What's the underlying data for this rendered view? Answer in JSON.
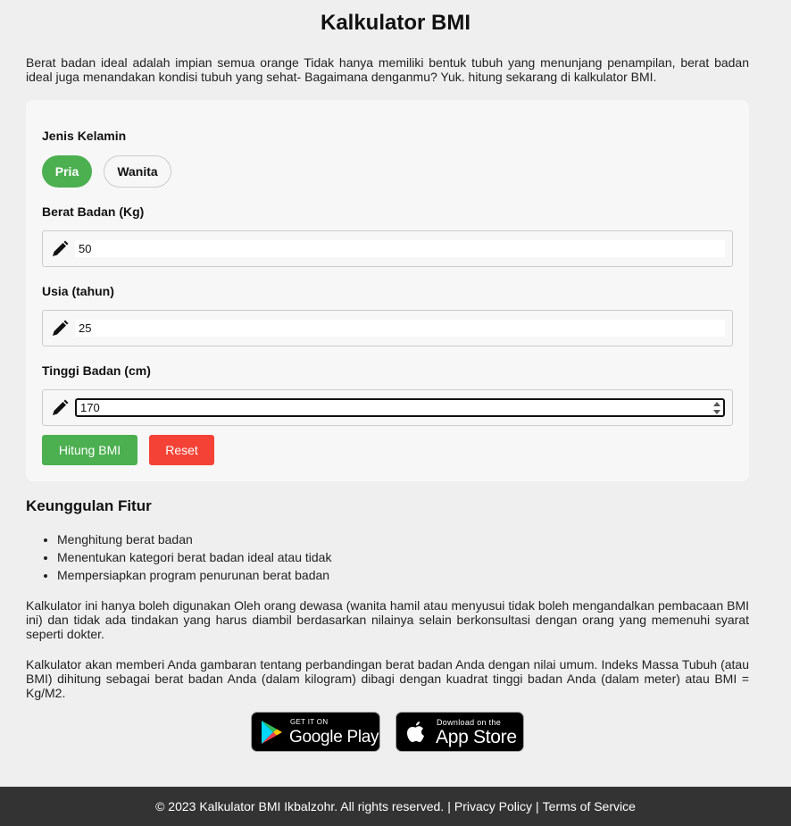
{
  "page": {
    "title": "Kalkulator BMI",
    "intro": "Berat badan ideal adalah impian semua orange Tidak hanya memiliki bentuk tubuh yang menunjang penampilan, berat badan ideal juga menandakan kondisi tubuh yang sehat- Bagaimana denganmu? Yuk. hitung sekarang di kalkulator BMI."
  },
  "form": {
    "gender_label": "Jenis Kelamin",
    "gender_options": [
      "Pria",
      "Wanita"
    ],
    "gender_selected": "Pria",
    "weight_label": "Berat Badan (Kg)",
    "weight_value": "50",
    "age_label": "Usia (tahun)",
    "age_value": "25",
    "height_label": "Tinggi Badan (cm)",
    "height_value": "170",
    "calculate_label": "Hitung BMI",
    "reset_label": "Reset"
  },
  "features": {
    "title": "Keunggulan Fitur",
    "items": [
      "Menghitung berat badan",
      "Menentukan kategori berat badan ideal atau tidak",
      "Mempersiapkan program penurunan berat badan"
    ]
  },
  "paragraphs": [
    "Kalkulator ini hanya boleh digunakan Oleh orang dewasa (wanita hamil atau menyusui tidak boleh mengandalkan pembacaan BMI ini) dan tidak ada tindakan yang harus diambil berdasarkan nilainya selain berkonsultasi dengan orang yang memenuhi syarat seperti dokter.",
    "Kalkulator akan memberi Anda gambaran tentang perbandingan berat badan Anda dengan nilai umum. Indeks Massa Tubuh (atau BMI) dihitung sebagai berat badan Anda (dalam kilogram) dibagi dengan kuadrat tinggi badan Anda (dalam meter) atau BMI = Kg/M2."
  ],
  "stores": {
    "google_small": "GET IT ON",
    "google_big": "Google Play",
    "apple_small": "Download on the",
    "apple_big": "App Store"
  },
  "footer": {
    "copyright": "© 2023 Kalkulator BMI Ikbalzohr. All rights reserved.",
    "separator": "|",
    "privacy": "Privacy Policy",
    "terms": "Terms of Service"
  },
  "colors": {
    "primary": "#4caf50",
    "danger": "#f44336",
    "footer_bg": "#333333",
    "page_bg": "#efefef"
  },
  "icons": [
    "pencil-icon",
    "google-play-icon",
    "apple-icon"
  ]
}
